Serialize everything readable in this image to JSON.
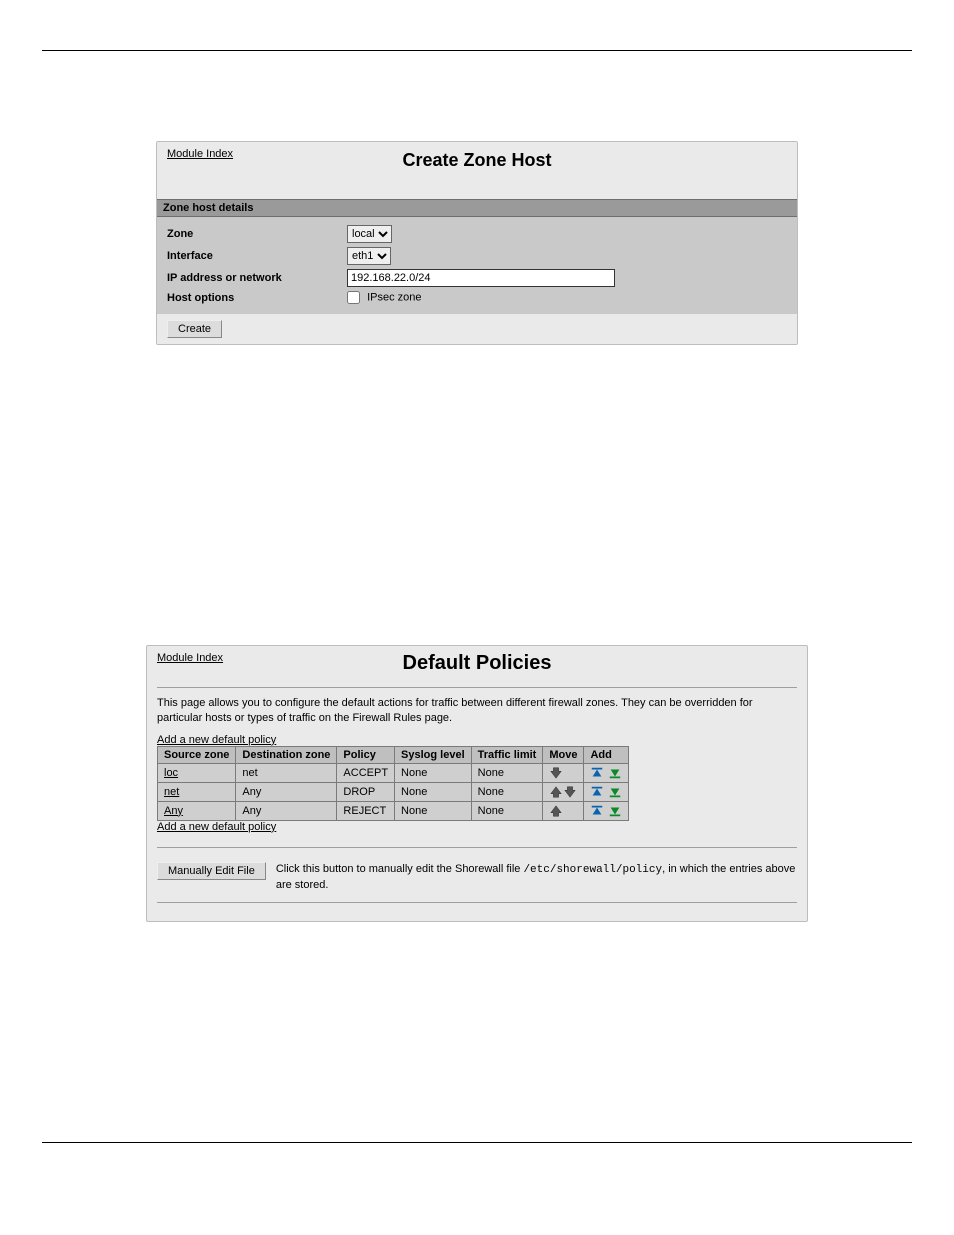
{
  "panel1": {
    "module_index": "Module Index",
    "title": "Create Zone Host",
    "section_header": "Zone host details",
    "rows": {
      "zone_label": "Zone",
      "zone_value": "local",
      "interface_label": "Interface",
      "interface_value": "eth1",
      "ip_label": "IP address or network",
      "ip_value": "192.168.22.0/24",
      "hostopts_label": "Host options",
      "ipsec_label": "IPsec zone"
    },
    "create_button": "Create"
  },
  "panel2": {
    "module_index": "Module Index",
    "title": "Default Policies",
    "description": "This page allows you to configure the default actions for traffic between different firewall zones. They can be overridden for particular hosts or types of traffic on the Firewall Rules page.",
    "add_link": "Add a new default policy",
    "headers": {
      "source": "Source zone",
      "dest": "Destination zone",
      "policy": "Policy",
      "syslog": "Syslog level",
      "limit": "Traffic limit",
      "move": "Move",
      "add": "Add"
    },
    "rows": [
      {
        "source": "loc",
        "dest": "net",
        "policy": "ACCEPT",
        "syslog": "None",
        "limit": "None",
        "up": false,
        "down": true
      },
      {
        "source": "net",
        "dest": "Any",
        "policy": "DROP",
        "syslog": "None",
        "limit": "None",
        "up": true,
        "down": true
      },
      {
        "source": "Any",
        "dest": "Any",
        "policy": "REJECT",
        "syslog": "None",
        "limit": "None",
        "up": true,
        "down": false
      }
    ],
    "manual_button": "Manually Edit File",
    "manual_text_prefix": "Click this button to manually edit the Shorewall file ",
    "manual_text_path": "/etc/shorewall/policy",
    "manual_text_suffix": ", in which the entries above are stored."
  }
}
